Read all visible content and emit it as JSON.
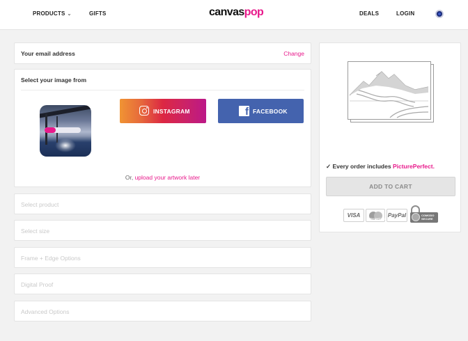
{
  "header": {
    "nav": {
      "products": "PRODUCTS",
      "gifts": "GIFTS",
      "deals": "DEALS",
      "login": "LOGIN"
    },
    "logo": {
      "part1": "canvas",
      "part2": "pop"
    }
  },
  "email": {
    "label": "Your email address",
    "change": "Change"
  },
  "image_select": {
    "title": "Select your image from",
    "upload_progress": 0.3,
    "instagram": "INSTAGRAM",
    "facebook": "FACEBOOK",
    "upload_later_prefix": "Or,",
    "upload_later_link": "upload your artwork later"
  },
  "steps": [
    {
      "label": "Select product"
    },
    {
      "label": "Select size"
    },
    {
      "label": "Frame + Edge Options"
    },
    {
      "label": "Digital Proof"
    },
    {
      "label": "Advanced Options"
    }
  ],
  "sidebar": {
    "order_note_prefix": "✓ Every order includes",
    "order_note_brand": "PicturePerfect.",
    "add_to_cart": "ADD TO CART",
    "payments": {
      "visa": "VISA",
      "mastercard": "MasterCard",
      "paypal": "PayPal",
      "secure_line1": "COMODO",
      "secure_line2": "SECURE"
    }
  },
  "colors": {
    "accent": "#e8198b",
    "facebook": "#4463ae",
    "background": "#f2f2f2"
  }
}
